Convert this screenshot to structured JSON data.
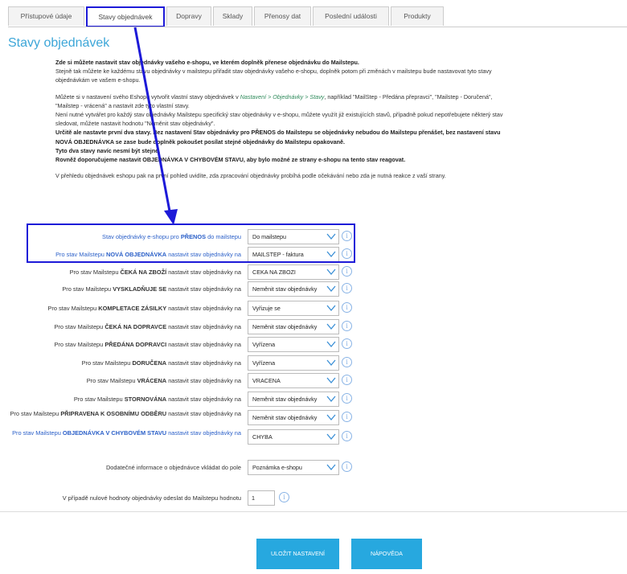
{
  "tabs": [
    {
      "label": "Přístupové údaje"
    },
    {
      "label": "Stavy objednávek"
    },
    {
      "label": "Dopravy"
    },
    {
      "label": "Sklady"
    },
    {
      "label": "Přenosy dat"
    },
    {
      "label": "Poslední události"
    },
    {
      "label": "Produkty"
    }
  ],
  "page_title": "Stavy objednávek",
  "intro": {
    "line1": "Zde si můžete nastavit stav objednávky vašeho e-shopu, ve kterém doplněk přenese objednávku do Mailstepu.",
    "line2": "Stejně tak můžete ke každému stavu objednávky v mailstepu přiřadit stav objednávky vašeho e-shopu, doplněk potom při změnách v mailstepu bude nastavovat tyto stavy",
    "line3": "objednávkám ve vašem e-shopu.",
    "line4a": "Můžete si v nastavení svého Eshopu vytvořit vlastní stavy objednávek v ",
    "line4path": "Nastavení > Objednávky > Stavy",
    "line4b": ", například \"MailStep - Předána přepravci\", \"Mailstep - Doručená\",",
    "line5": "\"Mailstep - vrácená\" a nastavit zde tyto vlastní stavy.",
    "line6": "Není nutné vytvářet pro každý stav objednávky Mailstepu specifický stav objednávky v e-shopu, můžete využít již existujících stavů, případně pokud nepotřebujete některý stav",
    "line7": "sledovat, můžete nastavit hodnotu \"Neměnit stav objednávky\".",
    "line8": "Určitě ale nastavte první dva stavy. Bez nastavení Stav objednávky pro PŘENOS do Mailstepu se objednávky nebudou do Mailstepu přenášet, bez nastavení stavu",
    "line9": "NOVÁ OBJEDNÁVKA se zase bude doplněk pokoušet posílat stejné objednávky do Mailstepu opakovaně.",
    "line10": "Tyto dva stavy navíc nesmí být stejné.",
    "line11": "Rovněž doporučujeme nastavit OBJEDNÁVKA V CHYBOVÉM STAVU, aby bylo možné ze strany e-shopu na tento stav reagovat.",
    "line12": "V přehledu objednávek eshopu pak na první pohled uvidíte, zda zpracování objednávky probíhá podle očekávání nebo zda je nutná reakce z vaší strany."
  },
  "rows": [
    {
      "pre": "Stav objednávky e-shopu pro ",
      "bold": "PŘENOS",
      "post": " do mailstepu",
      "value": "Do mailstepu"
    },
    {
      "pre": "Pro stav Mailstepu ",
      "bold": "NOVÁ OBJEDNÁVKA",
      "post": " nastavit stav objednávky na",
      "value": "MAILSTEP - faktura"
    },
    {
      "pre": "Pro stav Mailstepu ",
      "bold": "ČEKÁ NA ZBOŽÍ",
      "post": " nastavit stav objednávky na",
      "value": "CEKA NA ZBOZI"
    },
    {
      "pre": "Pro stav Mailstepu ",
      "bold": "VYSKLADŇUJE SE",
      "post": " nastavit stav objednávky na",
      "value": "Neměnit stav objednávky"
    },
    {
      "pre": "Pro stav Mailstepu ",
      "bold": "KOMPLETACE ZÁSILKY",
      "post": " nastavit stav objednávky na",
      "value": "Vyřizuje se"
    },
    {
      "pre": "Pro stav Mailstepu ",
      "bold": "ČEKÁ NA DOPRAVCE",
      "post": " nastavit stav objednávky na",
      "value": "Neměnit stav objednávky"
    },
    {
      "pre": "Pro stav Mailstepu ",
      "bold": "PŘEDÁNA DOPRAVCI",
      "post": " nastavit stav objednávky na",
      "value": "Vyřízena"
    },
    {
      "pre": "Pro stav Mailstepu ",
      "bold": "DORUČENA",
      "post": " nastavit stav objednávky na",
      "value": "Vyřízena"
    },
    {
      "pre": "Pro stav Mailstepu ",
      "bold": "VRÁCENA",
      "post": " nastavit stav objednávky na",
      "value": "VRACENA"
    },
    {
      "pre": "Pro stav Mailstepu ",
      "bold": "STORNOVÁNA",
      "post": " nastavit stav objednávky na",
      "value": "Neměnit stav objednávky"
    },
    {
      "pre": "Pro stav Mailstepu ",
      "bold": "PŘIPRAVENA K OSOBNÍMU ODBĚRU",
      "post": " nastavit stav objednávky na",
      "value": "Neměnit stav objednávky"
    },
    {
      "pre": "Pro stav Mailstepu ",
      "bold": "OBJEDNÁVKA V CHYBOVÉM STAVU",
      "post": " nastavit stav objednávky na",
      "value": "CHYBA"
    }
  ],
  "extra_info": {
    "label": "Dodatečné informace o objednávce vkládat do pole",
    "value": "Poznámka e-shopu"
  },
  "zero_value": {
    "label": "V případě nulové hodnoty objednávky odeslat do Mailstepu hodnotu",
    "value": "1"
  },
  "info_glyph": "i",
  "buttons": {
    "save": "ULOŽIT NASTAVENÍ",
    "help": "NÁPOVĚDA"
  },
  "colors": {
    "accent": "#27a8df",
    "highlight": "#1d1ad8",
    "title": "#3ca6d8",
    "blue_label": "#2a5fc8"
  }
}
